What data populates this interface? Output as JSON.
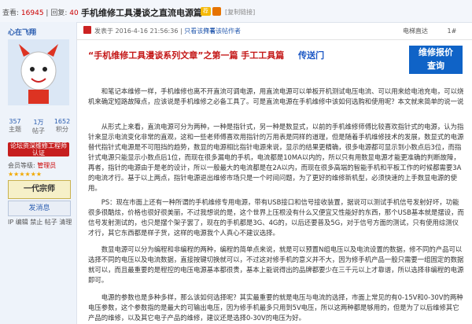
{
  "topbar": {
    "views_label": "查看:",
    "views": "16945",
    "replies_label": "回复:",
    "replies": "40",
    "title": "手机维修工具漫谈之直流电源篇",
    "copy_link": "[复制链接]"
  },
  "user": {
    "name": "心在飞翔",
    "counts": [
      {
        "n": "357",
        "l": "主题"
      },
      {
        "n": "1万",
        "l": "帖子"
      },
      {
        "n": "1652",
        "l": "积分"
      }
    ],
    "certified": "论坛资深维修工程师认证",
    "group_label": "会员等级:",
    "group_value": "管理员",
    "rank": "一代宗师",
    "send_msg": "发消息",
    "ip_line": "IP 编辑 禁止 帖子 清理"
  },
  "post": {
    "time": "发表于 2016-4-16 21:56:36",
    "view_author": "只看该作者",
    "only_host": "只看该帖作者",
    "electric_label": "电梯直达",
    "floor": "1#",
    "headline_red": "“手机维修工具漫谈系列文章”之第一篇 手工工具篇",
    "headline_link": "传送门",
    "ad_line1": "维修报价",
    "ad_line2": "查询",
    "paragraphs": [
      "和笔记本维修一样，手机维修也离不开直流可调电源，用直流电源可以单板开机测试电压电流、可以用来给电池充电，可以烧机来确定短路故障点，应该说是手机维修之必备工具了。可是直流电源在手机维修中该如何选购和使用呢？本文就来简单的说一说",
      "从形式上来看，直流电源可分为两种，一种是指针式，另一种是数显式，以前的手机维修师傅比较喜欢指针式的电源，认为指针来显示电流变化非常的直观，这和一些老师傅喜欢用指针的万用表是同样的道理，但是随着手机维修技术的发展，数显式的电源替代指针式电源是不可阻挡的趋势，数显的电源相比指针电源来说，显示的结果更精确，很多电源都可显示到小数点后3位，而指针式电源只能显示小数点后1位，而现在很多漏电的手机，电流都是10MA以内的，所以只有用数显电源才能更准确的判断故障，再者，指针的电源由于是老的设计，所以一般最大的电流都是在2A以内，而现在很多高端的智能手机和平板工作的时候都需要3A的电流才行。基于以上两点，指针电源退出维修市场只是一个时间问题，为了更好的维修新机型，必须快速的上手数显电源的使用。",
      "PS：现在市面上还有一种所谓的手机维修专用电源，带有USB接口和信号接收装置，据说可以测试手机信号发射好坏，功能很多很酷炫，价格也很好很美丽，不过我想说的是，这个世界上压根没有什么又便宜又性能好的东西，那个USB基本就是摆设，而信号发射测试的，也只是摆个架子罢了，现在的手机都是3G、4G的，以后还要普及5G，对于信号方面的测试，只有使用综测仪才行，其它东西都是样子货，这样的电源我个人真心不建议选择。",
      "数显电源可以分为编程和非编程的两种，编程的简单点来说，就是可以预置N组电压以及电流设置的数据，修不同的产品可以选择不同的电压以及电流数据，直接按键切换就可以，不过这对修手机的意义并不大，因为修手机产品一般只需要一组固定的数据就可以，而且最重要的是程控的电压电源基本都很贵，基本上能说得出的品牌都要少在三千元以上才靠谱，所以选择非编程的电源即可。",
      "电源的参数也是多种多样，那么该如何选择呢？其实最重要的就是电压与电流的选择，市面上常见的有0-15V和0-30V的两种电压参数，这个参数指的是最大的可输出电压，因为修手机最多只用到5V电压，所以这两种都是够用的，但是为了以后维修其它产品的维修，以及其它电子产品的维修，建议还是选择0-30V的电压为好。"
    ]
  }
}
